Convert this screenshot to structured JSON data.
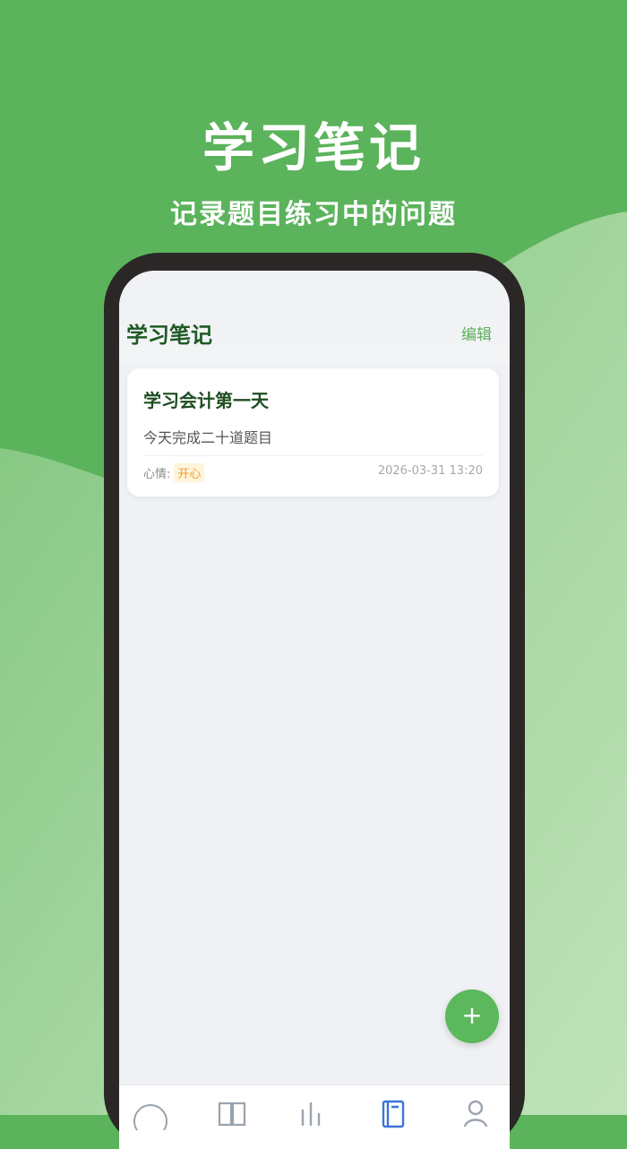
{
  "promo": {
    "title": "学习笔记",
    "subtitle": "记录题目练习中的问题"
  },
  "app": {
    "header_title": "学习笔记",
    "edit_label": "编辑"
  },
  "notes": [
    {
      "title": "学习会计第一天",
      "content": "今天完成二十道题目",
      "mood_label": "心情:",
      "mood_value": "开心",
      "date": "2026-03-31 13:20"
    }
  ],
  "fab": {
    "label": "+"
  },
  "tabs": [
    {
      "icon": "home-icon",
      "active": false
    },
    {
      "icon": "book-icon",
      "active": false
    },
    {
      "icon": "bar-chart-icon",
      "active": false
    },
    {
      "icon": "notebook-icon",
      "active": true
    },
    {
      "icon": "user-icon",
      "active": false
    }
  ],
  "colors": {
    "brand_green": "#5bb35b",
    "title_green": "#1f5a24",
    "accent_green": "#5fae5f",
    "fab_green": "#5cb85c",
    "mood_orange": "#f0a020",
    "active_tab_blue": "#3a74d8",
    "inactive_tab_gray": "#9aa3ad",
    "phone_frame": "#2a2726"
  }
}
